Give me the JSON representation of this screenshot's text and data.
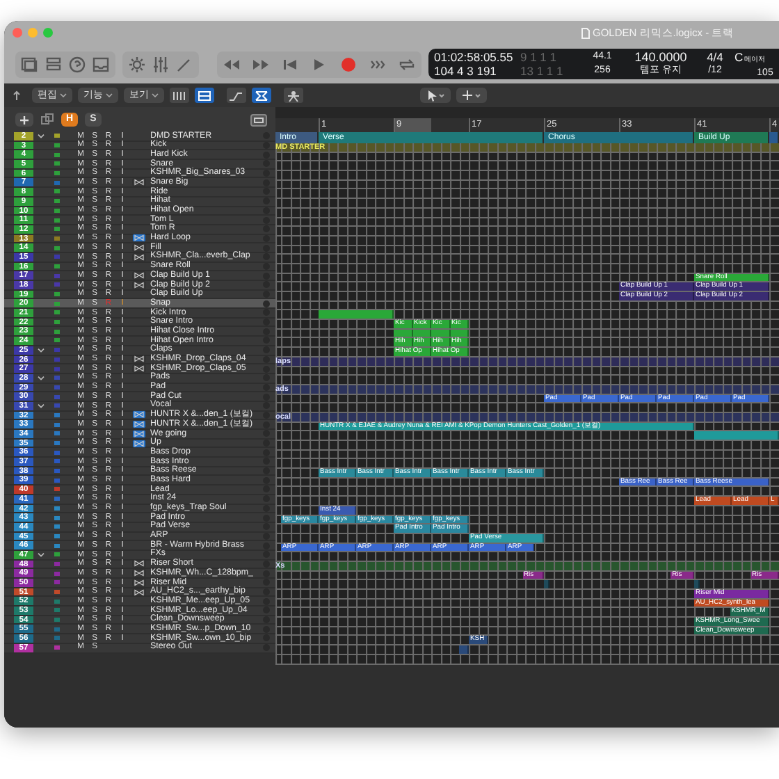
{
  "window": {
    "title": "GOLDEN 리믹스.logicx - 트랙"
  },
  "lcd": {
    "time": "01:02:58:05.55",
    "position": "104  4  3  191",
    "locator_left": "9  1  1  1",
    "locator_right": "13  1  1  1",
    "sample_rate": "44.1",
    "buffer": "256",
    "tempo": "140.0000",
    "tempo_mode": "템포 유지",
    "signature": "4/4",
    "division": "/12",
    "key": "C",
    "scale": "메이저",
    "key_value": "105"
  },
  "menus": [
    "편집",
    "기능",
    "보기"
  ],
  "view_buttons": [
    {
      "kind": "grid",
      "selected": false
    },
    {
      "kind": "list",
      "selected": true
    },
    {
      "kind": "curve",
      "selected": false
    },
    {
      "kind": "flex",
      "selected": true
    },
    {
      "kind": "person",
      "selected": false
    }
  ],
  "header_buttons": [
    {
      "label": "H",
      "selected": true
    },
    {
      "label": "S",
      "selected": false
    }
  ],
  "ruler": {
    "ticks": [
      "1",
      "9",
      "17",
      "25",
      "33",
      "41",
      "4"
    ]
  },
  "markers": [
    {
      "label": "Intro",
      "color": "#3d5a80"
    },
    {
      "label": "Verse",
      "color": "#1f7a7a"
    },
    {
      "label": "Chorus",
      "color": "#1f6f80"
    },
    {
      "label": "Build Up",
      "color": "#1f7a55"
    },
    {
      "color": "#2a5a90"
    }
  ],
  "tracks": [
    {
      "number": "2",
      "name": "DMD STARTER",
      "color": "#a3a32a",
      "folder": true,
      "flex": false,
      "flex_on": false,
      "selected": false,
      "controls": [
        "M",
        "S",
        "R",
        "I"
      ],
      "lane_label": "MD STARTER"
    },
    {
      "number": "3",
      "name": "Kick",
      "color": "#2ea03c",
      "folder": false,
      "flex": false,
      "flex_on": false,
      "selected": false,
      "controls": [
        "M",
        "S",
        "R",
        "I"
      ]
    },
    {
      "number": "4",
      "name": "Hard Kick",
      "color": "#2ea03c",
      "folder": false,
      "flex": false,
      "flex_on": false,
      "selected": false,
      "controls": [
        "M",
        "S",
        "R",
        "I"
      ]
    },
    {
      "number": "5",
      "name": "Snare",
      "color": "#2ea03c",
      "folder": false,
      "flex": false,
      "flex_on": false,
      "selected": false,
      "controls": [
        "M",
        "S",
        "R",
        "I"
      ]
    },
    {
      "number": "6",
      "name": "KSHMR_Big_Snares_03",
      "color": "#2ea03c",
      "folder": false,
      "flex": false,
      "flex_on": false,
      "selected": false,
      "controls": [
        "M",
        "S",
        "R",
        "I"
      ]
    },
    {
      "number": "7",
      "name": "Snare Big",
      "color": "#2068b0",
      "folder": false,
      "flex": true,
      "flex_on": false,
      "selected": false,
      "controls": [
        "M",
        "S",
        "R",
        "I"
      ]
    },
    {
      "number": "8",
      "name": "Ride",
      "color": "#2ea03c",
      "folder": false,
      "flex": false,
      "flex_on": false,
      "selected": false,
      "controls": [
        "M",
        "S",
        "R",
        "I"
      ]
    },
    {
      "number": "9",
      "name": "Hihat",
      "color": "#2ea03c",
      "folder": false,
      "flex": false,
      "flex_on": false,
      "selected": false,
      "controls": [
        "M",
        "S",
        "R",
        "I"
      ]
    },
    {
      "number": "10",
      "name": "Hihat Open",
      "color": "#2ea03c",
      "folder": false,
      "flex": false,
      "flex_on": false,
      "selected": false,
      "controls": [
        "M",
        "S",
        "R",
        "I"
      ]
    },
    {
      "number": "11",
      "name": "Tom L",
      "color": "#2ea03c",
      "folder": false,
      "flex": false,
      "flex_on": false,
      "selected": false,
      "controls": [
        "M",
        "S",
        "R",
        "I"
      ]
    },
    {
      "number": "12",
      "name": "Tom R",
      "color": "#2ea03c",
      "folder": false,
      "flex": false,
      "flex_on": false,
      "selected": false,
      "controls": [
        "M",
        "S",
        "R",
        "I"
      ]
    },
    {
      "number": "13",
      "name": "Hard Loop",
      "color": "#8c7a22",
      "folder": false,
      "flex": true,
      "flex_on": true,
      "selected": false,
      "controls": [
        "M",
        "S",
        "R",
        "I"
      ]
    },
    {
      "number": "14",
      "name": "Fill",
      "color": "#2ea03c",
      "folder": false,
      "flex": true,
      "flex_on": false,
      "selected": false,
      "controls": [
        "M",
        "S",
        "R",
        "I"
      ]
    },
    {
      "number": "15",
      "name": "KSHMR_Cla...everb_Clap",
      "color": "#3c38a8",
      "folder": false,
      "flex": true,
      "flex_on": false,
      "selected": false,
      "controls": [
        "M",
        "S",
        "R",
        "I"
      ]
    },
    {
      "number": "16",
      "name": "Snare Roll",
      "color": "#2ea03c",
      "folder": false,
      "flex": false,
      "flex_on": false,
      "selected": false,
      "controls": [
        "M",
        "S",
        "R",
        "I"
      ],
      "regions": [
        {
          "label": "Snare Roll",
          "color": "#2aa838"
        }
      ]
    },
    {
      "number": "17",
      "name": "Clap Build Up 1",
      "color": "#4a38a8",
      "folder": false,
      "flex": true,
      "flex_on": false,
      "selected": false,
      "controls": [
        "M",
        "S",
        "R",
        "I"
      ],
      "regions": [
        {
          "label": "Clap Build Up 1",
          "color": "#3a2c72"
        },
        {
          "label": "Clap Build Up 1",
          "color": "#3a2c72"
        }
      ]
    },
    {
      "number": "18",
      "name": "Clap Build Up 2",
      "color": "#4a38a8",
      "folder": false,
      "flex": true,
      "flex_on": false,
      "selected": false,
      "controls": [
        "M",
        "S",
        "R",
        "I"
      ],
      "regions": [
        {
          "label": "Clap Build Up 2",
          "color": "#3a2c72"
        },
        {
          "label": "Clap Build Up 2",
          "color": "#3a2c72"
        }
      ]
    },
    {
      "number": "19",
      "name": "Clap Build Up",
      "color": "#2ea03c",
      "folder": false,
      "flex": false,
      "flex_on": false,
      "selected": false,
      "controls": [
        "M",
        "S",
        "R",
        "I"
      ]
    },
    {
      "number": "20",
      "name": "Snap",
      "color": "#2ea03c",
      "folder": false,
      "flex": false,
      "flex_on": false,
      "selected": true,
      "controls": [
        "M",
        "S",
        "R",
        "I"
      ],
      "regions": [
        {
          "color": "#2aa838"
        }
      ]
    },
    {
      "number": "21",
      "name": "Kick Intro",
      "color": "#2ea03c",
      "folder": false,
      "flex": false,
      "flex_on": false,
      "selected": false,
      "controls": [
        "M",
        "S",
        "R",
        "I"
      ],
      "regions": [
        {
          "label": "Kic",
          "color": "#2aa838"
        },
        {
          "label": "Kick",
          "color": "#2aa838"
        },
        {
          "label": "Kic",
          "color": "#2aa838"
        },
        {
          "label": "Kic",
          "color": "#2aa838"
        }
      ]
    },
    {
      "number": "22",
      "name": "Snare Intro",
      "color": "#2ea03c",
      "folder": false,
      "flex": false,
      "flex_on": false,
      "selected": false,
      "controls": [
        "M",
        "S",
        "R",
        "I"
      ],
      "regions": [
        {
          "color": "#2aa838"
        },
        {
          "color": "#2aa838"
        },
        {
          "color": "#2aa838"
        },
        {
          "color": "#2aa838"
        }
      ]
    },
    {
      "number": "23",
      "name": "Hihat Close Intro",
      "color": "#2ea03c",
      "folder": false,
      "flex": false,
      "flex_on": false,
      "selected": false,
      "controls": [
        "M",
        "S",
        "R",
        "I"
      ],
      "regions": [
        {
          "label": "Hih",
          "color": "#2aa838"
        },
        {
          "label": "Hih",
          "color": "#2aa838"
        },
        {
          "label": "Hih",
          "color": "#2aa838"
        },
        {
          "label": "Hih",
          "color": "#2aa838"
        }
      ]
    },
    {
      "number": "24",
      "name": "Hihat Open Intro",
      "color": "#2ea03c",
      "folder": false,
      "flex": false,
      "flex_on": false,
      "selected": false,
      "controls": [
        "M",
        "S",
        "R",
        "I"
      ],
      "regions": [
        {
          "label": "Hihat Op",
          "color": "#2aa838"
        },
        {
          "label": "Hihat Op",
          "color": "#2aa838"
        }
      ]
    },
    {
      "number": "25",
      "name": "Claps",
      "color": "#3c38a8",
      "folder": true,
      "flex": false,
      "flex_on": false,
      "selected": false,
      "controls": [
        "M",
        "S",
        "R",
        "I"
      ],
      "lane_label": "laps"
    },
    {
      "number": "26",
      "name": "KSHMR_Drop_Claps_04",
      "color": "#3c38a8",
      "folder": false,
      "flex": true,
      "flex_on": false,
      "selected": false,
      "controls": [
        "M",
        "S",
        "R",
        "I"
      ]
    },
    {
      "number": "27",
      "name": "KSHMR_Drop_Claps_05",
      "color": "#3c38a8",
      "folder": false,
      "flex": true,
      "flex_on": false,
      "selected": false,
      "controls": [
        "M",
        "S",
        "R",
        "I"
      ]
    },
    {
      "number": "28",
      "name": "Pads",
      "color": "#3848b0",
      "folder": true,
      "flex": false,
      "flex_on": false,
      "selected": false,
      "controls": [
        "M",
        "S",
        "R",
        "I"
      ],
      "lane_label": "ads"
    },
    {
      "number": "29",
      "name": "Pad",
      "color": "#3848b0",
      "folder": false,
      "flex": false,
      "flex_on": false,
      "selected": false,
      "controls": [
        "M",
        "S",
        "R",
        "I"
      ],
      "regions": [
        {
          "label": "Pad",
          "color": "#3a68d0"
        },
        {
          "label": "Pad",
          "color": "#3a68d0"
        },
        {
          "label": "Pad",
          "color": "#3a68d0"
        },
        {
          "label": "Pad",
          "color": "#3a68d0"
        },
        {
          "label": "Pad",
          "color": "#3a68d0"
        },
        {
          "label": "Pad",
          "color": "#3a68d0"
        }
      ]
    },
    {
      "number": "30",
      "name": "Pad Cut",
      "color": "#3848b0",
      "folder": false,
      "flex": false,
      "flex_on": false,
      "selected": false,
      "controls": [
        "M",
        "S",
        "R",
        "I"
      ]
    },
    {
      "number": "31",
      "name": "Vocal",
      "color": "#3848b0",
      "folder": true,
      "flex": false,
      "flex_on": false,
      "selected": false,
      "controls": [
        "M",
        "S",
        "R",
        "I"
      ],
      "lane_label": "ocal"
    },
    {
      "number": "32",
      "name": "HUNTR X &...den_1 (보컬)",
      "color": "#2a78c0",
      "folder": false,
      "flex": true,
      "flex_on": true,
      "selected": false,
      "controls": [
        "M",
        "S",
        "R",
        "I"
      ],
      "regions": [
        {
          "label": "HUNTR X & EJAE & Audrey Nuna & REI AMI & KPop Demon Hunters Cast_Golden_1 (보컬)",
          "color": "#1f9a9a"
        }
      ]
    },
    {
      "number": "33",
      "name": "HUNTR X &...den_1 (보컬)",
      "color": "#2a78c0",
      "folder": false,
      "flex": true,
      "flex_on": true,
      "selected": false,
      "controls": [
        "M",
        "S",
        "R",
        "I"
      ],
      "regions": [
        {
          "color": "#1f9a9a"
        }
      ]
    },
    {
      "number": "34",
      "name": "We going",
      "color": "#2a78c0",
      "folder": false,
      "flex": true,
      "flex_on": true,
      "selected": false,
      "controls": [
        "M",
        "S",
        "R",
        "I"
      ]
    },
    {
      "number": "35",
      "name": "Up",
      "color": "#2a78c0",
      "folder": false,
      "flex": true,
      "flex_on": true,
      "selected": false,
      "controls": [
        "M",
        "S",
        "R",
        "I"
      ]
    },
    {
      "number": "36",
      "name": "Bass Drop",
      "color": "#2a58c0",
      "folder": false,
      "flex": false,
      "flex_on": false,
      "selected": false,
      "controls": [
        "M",
        "S",
        "R",
        "I"
      ]
    },
    {
      "number": "37",
      "name": "Bass Intro",
      "color": "#2a58c0",
      "folder": false,
      "flex": false,
      "flex_on": false,
      "selected": false,
      "controls": [
        "M",
        "S",
        "R",
        "I"
      ],
      "regions": [
        {
          "label": "Bass Intr",
          "color": "#2a8a9a"
        },
        {
          "label": "Bass Intr",
          "color": "#2a8a9a"
        },
        {
          "label": "Bass Intr",
          "color": "#2a8a9a"
        },
        {
          "label": "Bass Intr",
          "color": "#2a8a9a"
        },
        {
          "label": "Bass Intr",
          "color": "#2a8a9a"
        },
        {
          "label": "Bass Intr",
          "color": "#2a8a9a"
        }
      ]
    },
    {
      "number": "38",
      "name": "Bass Reese",
      "color": "#2a58c0",
      "folder": false,
      "flex": false,
      "flex_on": false,
      "selected": false,
      "controls": [
        "M",
        "S",
        "R",
        "I"
      ],
      "regions": [
        {
          "label": "Bass Ree",
          "color": "#3a62c8"
        },
        {
          "label": "Bass Ree",
          "color": "#3a62c8"
        },
        {
          "label": "Bass Reese",
          "color": "#3a62c8"
        }
      ]
    },
    {
      "number": "39",
      "name": "Bass Hard",
      "color": "#2a58c0",
      "folder": false,
      "flex": false,
      "flex_on": false,
      "selected": false,
      "controls": [
        "M",
        "S",
        "R",
        "I"
      ]
    },
    {
      "number": "40",
      "name": "Lead",
      "color": "#c0392a",
      "folder": false,
      "flex": false,
      "flex_on": false,
      "selected": false,
      "controls": [
        "M",
        "S",
        "R",
        "I"
      ],
      "regions": [
        {
          "label": "Lead",
          "color": "#c04a20"
        },
        {
          "label": "Lead",
          "color": "#c04a20"
        },
        {
          "label": "L",
          "color": "#c04a20"
        }
      ]
    },
    {
      "number": "41",
      "name": "Inst 24",
      "color": "#2a68c0",
      "folder": false,
      "flex": false,
      "flex_on": false,
      "selected": false,
      "controls": [
        "M",
        "S",
        "R",
        "I"
      ],
      "regions": [
        {
          "label": "Inst 24",
          "color": "#3a5ab0"
        }
      ]
    },
    {
      "number": "42",
      "name": "fgp_keys_Trap Soul",
      "color": "#2a88c0",
      "folder": false,
      "flex": false,
      "flex_on": false,
      "selected": false,
      "controls": [
        "M",
        "S",
        "R",
        "I"
      ],
      "regions": [
        {
          "label": "fgp_keys",
          "color": "#2a88a0"
        },
        {
          "label": "fgp_keys",
          "color": "#2a88a0"
        },
        {
          "label": "fgp_keys",
          "color": "#2a88a0"
        },
        {
          "label": "fgp_keys",
          "color": "#2a88a0"
        },
        {
          "label": "fgp_keys",
          "color": "#2a88a0"
        }
      ]
    },
    {
      "number": "43",
      "name": "Pad Intro",
      "color": "#2a88c0",
      "folder": false,
      "flex": false,
      "flex_on": false,
      "selected": false,
      "controls": [
        "M",
        "S",
        "R",
        "I"
      ],
      "regions": [
        {
          "label": "Pad Intro",
          "color": "#2a88a0"
        },
        {
          "label": "Pad Intro",
          "color": "#2a88a0"
        }
      ]
    },
    {
      "number": "44",
      "name": "Pad Verse",
      "color": "#2a88c0",
      "folder": false,
      "flex": false,
      "flex_on": false,
      "selected": false,
      "controls": [
        "M",
        "S",
        "R",
        "I"
      ],
      "regions": [
        {
          "label": "Pad Verse",
          "color": "#2a98a0"
        }
      ]
    },
    {
      "number": "45",
      "name": "ARP",
      "color": "#2a88c0",
      "folder": false,
      "flex": false,
      "flex_on": false,
      "selected": false,
      "controls": [
        "M",
        "S",
        "R",
        "I"
      ],
      "regions": [
        {
          "label": "ARP",
          "color": "#3a68d0"
        },
        {
          "label": "ARP",
          "color": "#3a68d0"
        },
        {
          "label": "ARP",
          "color": "#3a68d0"
        },
        {
          "label": "ARP",
          "color": "#3a68d0"
        },
        {
          "label": "ARP",
          "color": "#3a68d0"
        },
        {
          "label": "ARP",
          "color": "#3a68d0"
        },
        {
          "label": "ARP",
          "color": "#3a68d0"
        }
      ]
    },
    {
      "number": "46",
      "name": "BR - Warm Hybrid Brass",
      "color": "#2a88c0",
      "folder": false,
      "flex": false,
      "flex_on": false,
      "selected": false,
      "controls": [
        "M",
        "S",
        "R",
        "I"
      ]
    },
    {
      "number": "47",
      "name": "FXs",
      "color": "#2ea03c",
      "folder": true,
      "flex": false,
      "flex_on": false,
      "selected": false,
      "controls": [
        "M",
        "S",
        "R",
        "I"
      ],
      "lane_label": "Xs"
    },
    {
      "number": "48",
      "name": "Riser Short",
      "color": "#8c2aa0",
      "folder": false,
      "flex": true,
      "flex_on": false,
      "selected": false,
      "controls": [
        "M",
        "S",
        "R",
        "I"
      ],
      "regions": [
        {
          "label": "Ris",
          "color": "#8a2a8a"
        },
        {
          "label": "Ris",
          "color": "#8a2a8a"
        },
        {
          "label": "Ris",
          "color": "#8a2a8a"
        }
      ]
    },
    {
      "number": "49",
      "name": "KSHMR_Wh...C_128bpm_",
      "color": "#8c2aa0",
      "folder": false,
      "flex": true,
      "flex_on": false,
      "selected": false,
      "controls": [
        "M",
        "S",
        "R",
        "I"
      ],
      "regions": [
        {
          "color": "#1e4a5a"
        },
        {
          "color": "#1e4a5a"
        }
      ]
    },
    {
      "number": "50",
      "name": "Riser Mid",
      "color": "#8c2aa0",
      "folder": false,
      "flex": true,
      "flex_on": false,
      "selected": false,
      "controls": [
        "M",
        "S",
        "R",
        "I"
      ],
      "regions": [
        {
          "label": "Riser Mid",
          "color": "#7a2aa0"
        }
      ]
    },
    {
      "number": "51",
      "name": "AU_HC2_s..._earthy_bip",
      "color": "#c04a2a",
      "folder": false,
      "flex": true,
      "flex_on": false,
      "selected": false,
      "controls": [
        "M",
        "S",
        "R",
        "I"
      ],
      "regions": [
        {
          "label": "AU_HC2_synth_lea",
          "color": "#c04a20"
        }
      ]
    },
    {
      "number": "52",
      "name": "KSHMR_Me...eep_Up_05",
      "color": "#1e7a6a",
      "folder": false,
      "flex": false,
      "flex_on": false,
      "selected": false,
      "controls": [
        "M",
        "S",
        "R",
        "I"
      ],
      "regions": [
        {
          "label": "KSHMR_M",
          "color": "#1e6a50"
        }
      ]
    },
    {
      "number": "53",
      "name": "KSHMR_Lo...eep_Up_04",
      "color": "#1e7a6a",
      "folder": false,
      "flex": false,
      "flex_on": false,
      "selected": false,
      "controls": [
        "M",
        "S",
        "R",
        "I"
      ],
      "regions": [
        {
          "label": "KSHMR_Long_Swee",
          "color": "#1e6a50"
        }
      ]
    },
    {
      "number": "54",
      "name": "Clean_Downsweep",
      "color": "#1e7a6a",
      "folder": false,
      "flex": false,
      "flex_on": false,
      "selected": false,
      "controls": [
        "M",
        "S",
        "R",
        "I"
      ],
      "regions": [
        {
          "label": "Clean_Downsweep",
          "color": "#1e6a50"
        }
      ]
    },
    {
      "number": "55",
      "name": "KSHMR_Sw...p_Down_10",
      "color": "#1e6a8a",
      "folder": false,
      "flex": false,
      "flex_on": false,
      "selected": false,
      "controls": [
        "M",
        "S",
        "R",
        "I"
      ],
      "regions": [
        {
          "label": "KSH",
          "color": "#2a4a7a"
        }
      ]
    },
    {
      "number": "56",
      "name": "KSHMR_Sw...own_10_bip",
      "color": "#1e6a8a",
      "folder": false,
      "flex": false,
      "flex_on": false,
      "selected": false,
      "controls": [
        "M",
        "S",
        "R",
        "I"
      ],
      "regions": [
        {
          "color": "#2a4a7a"
        }
      ]
    },
    {
      "number": "57",
      "name": "Stereo Out",
      "color": "#b030a0",
      "folder": false,
      "flex": false,
      "flex_on": false,
      "selected": false,
      "controls": [
        "M",
        "S"
      ]
    }
  ]
}
